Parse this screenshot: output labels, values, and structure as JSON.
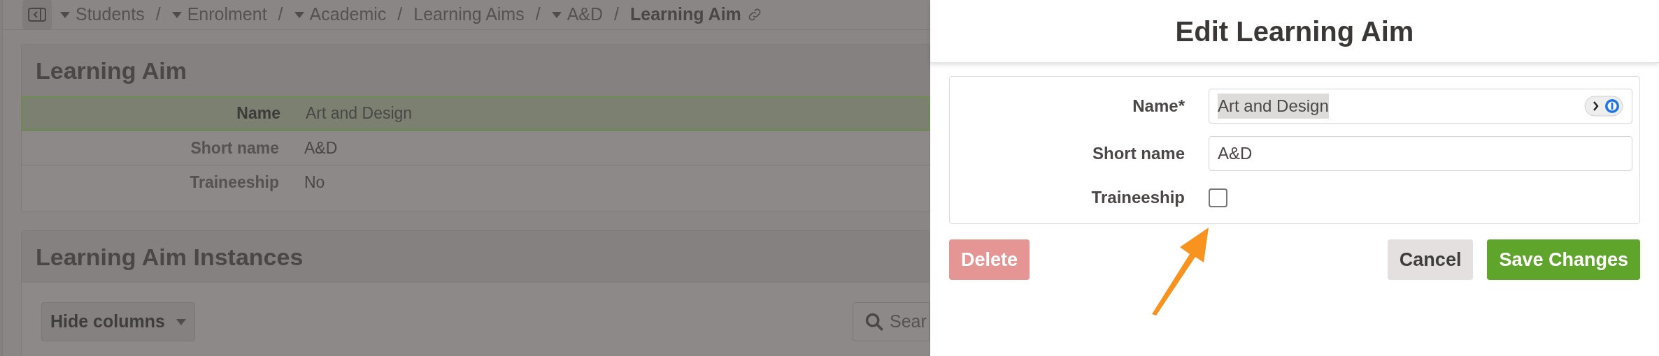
{
  "breadcrumb": {
    "items": [
      {
        "label": "Students",
        "dropdown": true,
        "current": false
      },
      {
        "label": "Enrolment",
        "dropdown": true,
        "current": false
      },
      {
        "label": "Academic",
        "dropdown": true,
        "current": false
      },
      {
        "label": "Learning Aims",
        "dropdown": false,
        "current": false
      },
      {
        "label": "A&D",
        "dropdown": true,
        "current": false
      },
      {
        "label": "Learning Aim",
        "dropdown": false,
        "current": true
      }
    ],
    "separator": "/"
  },
  "learning_aim_card": {
    "title": "Learning Aim",
    "rows": [
      {
        "label": "Name",
        "value": "Art and Design",
        "selected": true
      },
      {
        "label": "Short name",
        "value": "A&D",
        "selected": false
      },
      {
        "label": "Traineeship",
        "value": "No",
        "selected": false
      }
    ]
  },
  "instances_card": {
    "title": "Learning Aim Instances",
    "hide_columns_button": "Hide columns",
    "search": {
      "placeholder": "Sear"
    }
  },
  "dialog": {
    "title": "Edit Learning Aim",
    "fields": [
      {
        "kind": "text",
        "label": "Name*",
        "value": "Art and Design",
        "text_selected": true,
        "autofill_badge": true
      },
      {
        "kind": "text",
        "label": "Short name",
        "value": "A&D",
        "text_selected": false,
        "autofill_badge": false
      },
      {
        "kind": "checkbox",
        "label": "Traineeship",
        "checked": false
      }
    ],
    "buttons": [
      {
        "kind": "danger",
        "label": "Delete"
      },
      {
        "kind": "secondary",
        "label": "Cancel"
      },
      {
        "kind": "primary",
        "label": "Save Changes"
      }
    ]
  }
}
